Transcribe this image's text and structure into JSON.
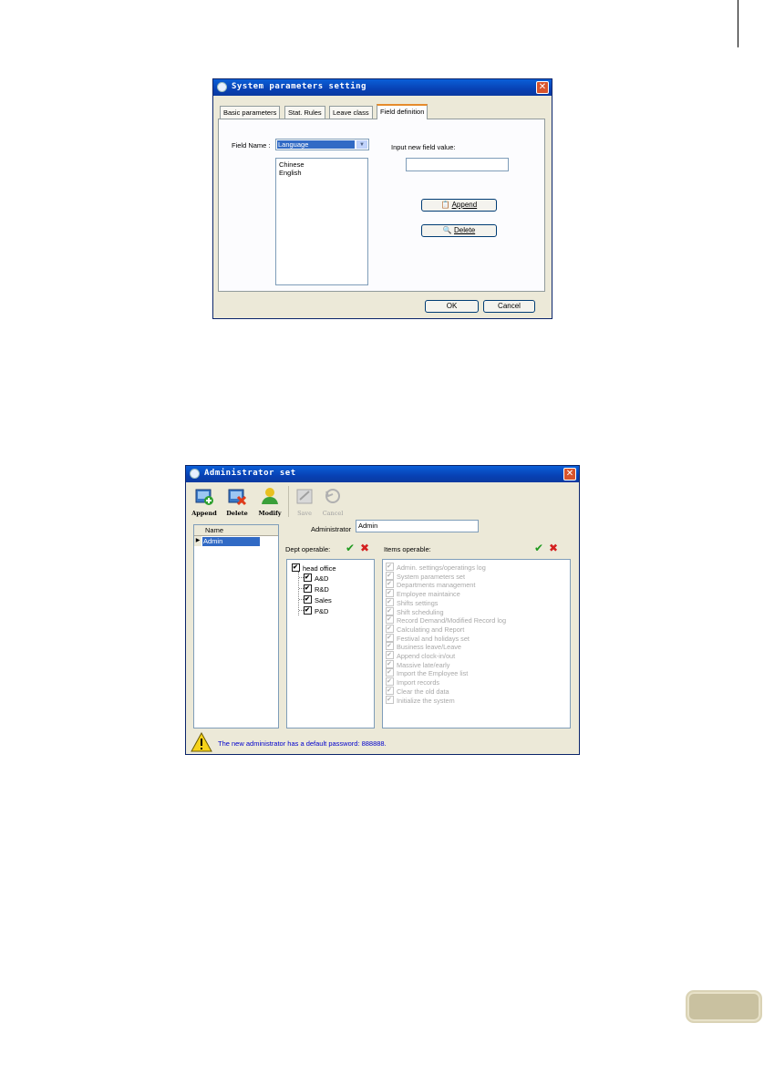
{
  "window1": {
    "title": "System parameters setting",
    "tabs": [
      "Basic parameters",
      "Stat. Rules",
      "Leave class",
      "Field definition"
    ],
    "field_name_label": "Field Name :",
    "field_name_value": "Language",
    "list_items": [
      "Chinese",
      "English"
    ],
    "new_value_label": "Input new field value:",
    "new_value": "",
    "append_label": "Append",
    "delete_label": "Delete",
    "ok_label": "OK",
    "cancel_label": "Cancel"
  },
  "window2": {
    "title": "Administrator set",
    "toolbar": [
      {
        "label": "Append",
        "enabled": true
      },
      {
        "label": "Delete",
        "enabled": true
      },
      {
        "label": "Modify",
        "enabled": true
      },
      {
        "label": "Save",
        "enabled": false
      },
      {
        "label": "Cancel",
        "enabled": false
      }
    ],
    "grid_header": "Name",
    "grid_rows": [
      "Admin"
    ],
    "administrator_label": "Administrator",
    "administrator_value": "Admin",
    "dept_label": "Dept operable:",
    "items_label": "Items operable:",
    "dept_tree": [
      {
        "label": "head office",
        "checked": true,
        "level": 0
      },
      {
        "label": "A&D",
        "checked": true,
        "level": 1
      },
      {
        "label": "R&D",
        "checked": true,
        "level": 1
      },
      {
        "label": "Sales",
        "checked": true,
        "level": 1
      },
      {
        "label": "P&D",
        "checked": true,
        "level": 1
      }
    ],
    "items": [
      "Admin. settings/operatings log",
      "System parameters set",
      "Departments management",
      "Employee maintaince",
      "Shifts settings",
      "Shift scheduling",
      "Record Demand/Modified Record log",
      "Calculating and Report",
      "Festival and holidays set",
      "Business leave/Leave",
      "Append clock-in/out",
      "Massive late/early",
      "Import the Employee list",
      "Import records",
      "Clear the old data",
      "Initialize the system"
    ],
    "status_message": "The new administrator has a default password: 888888."
  },
  "colors": {
    "titlebar": "#0a5fd8",
    "window_bg": "#ece9d8",
    "selection": "#316ac5",
    "status_text": "#0000cc",
    "page_tab": "#c9c1a0"
  }
}
